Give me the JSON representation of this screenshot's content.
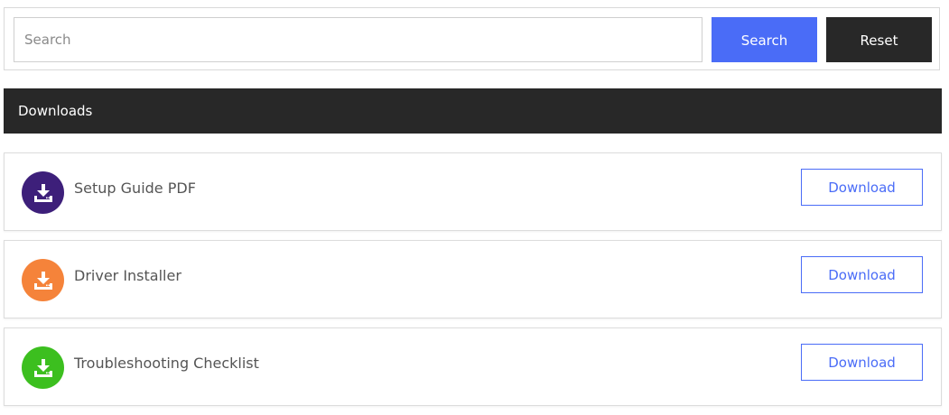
{
  "search": {
    "placeholder": "Search",
    "value": "",
    "search_label": "Search",
    "reset_label": "Reset"
  },
  "section": {
    "title": "Downloads"
  },
  "downloads": {
    "button_label": "Download",
    "items": [
      {
        "label": "Setup Guide PDF",
        "icon": "download-icon",
        "color": "#3d1f7a"
      },
      {
        "label": "Driver Installer",
        "icon": "download-icon",
        "color": "#f5833a"
      },
      {
        "label": "Troubleshooting Checklist",
        "icon": "download-icon",
        "color": "#3cbf1f"
      }
    ]
  },
  "colors": {
    "accent": "#4a6cf7",
    "dark": "#282828"
  }
}
